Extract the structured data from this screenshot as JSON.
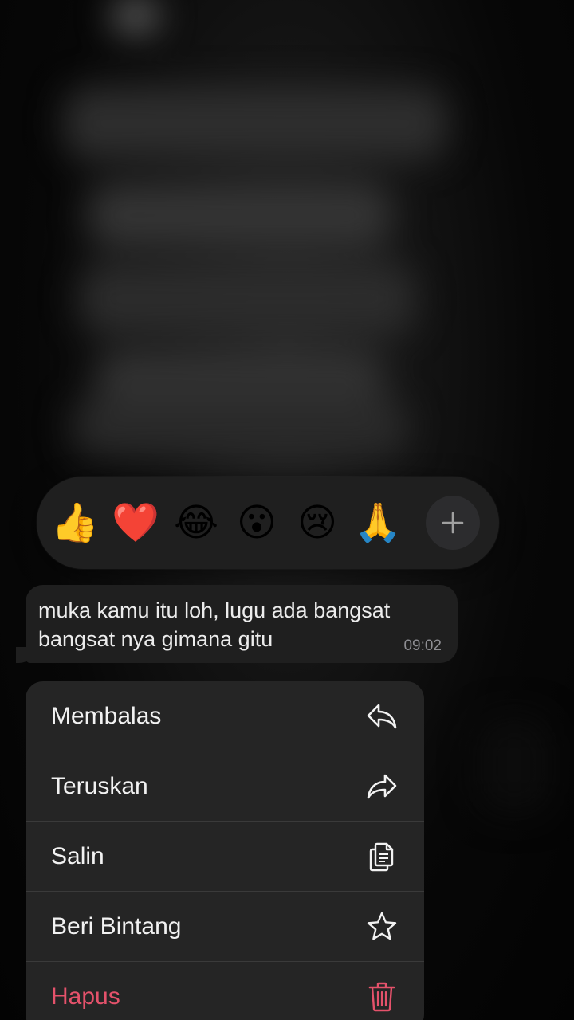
{
  "reactions": {
    "emojis": [
      "👍",
      "❤️",
      "😂",
      "😮",
      "😢",
      "🙏"
    ],
    "add_icon": "plus-icon"
  },
  "message": {
    "text": "muka kamu itu loh, lugu ada bangsat bangsat nya gimana gitu",
    "time": "09:02"
  },
  "menu": {
    "items": [
      {
        "label": "Membalas",
        "icon": "reply-icon"
      },
      {
        "label": "Teruskan",
        "icon": "forward-icon"
      },
      {
        "label": "Salin",
        "icon": "copy-icon"
      },
      {
        "label": "Beri Bintang",
        "icon": "star-icon"
      },
      {
        "label": "Hapus",
        "icon": "trash-icon"
      }
    ]
  },
  "colors": {
    "danger": "#e5526b",
    "menu_bg": "#252525",
    "bubble_bg": "#1f1f1f"
  }
}
